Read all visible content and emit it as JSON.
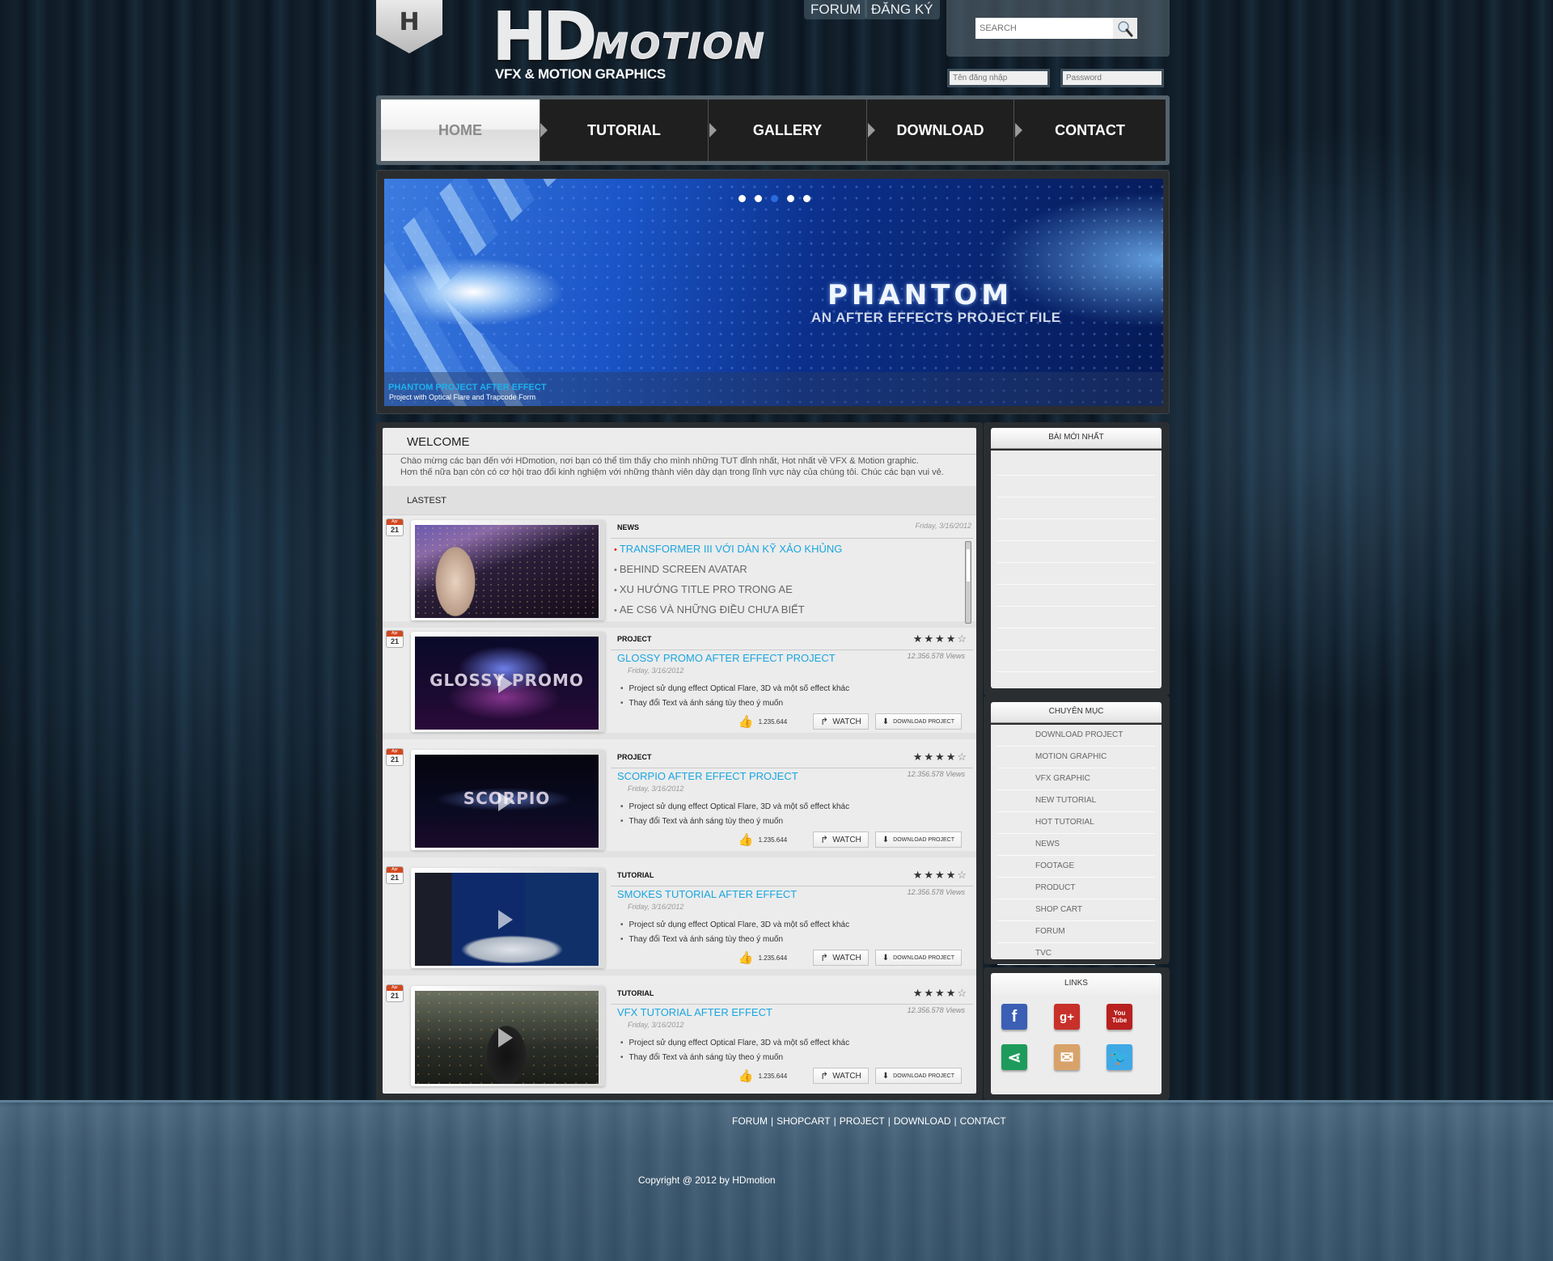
{
  "header": {
    "logo_badge_letter": "H",
    "logo_hd": "HD",
    "logo_motion": "MOTION",
    "tagline": "VFX & MOTION GRAPHICS",
    "top_links": [
      "FORUM",
      "ĐĂNG KÝ"
    ],
    "search_placeholder": "SEARCH",
    "search_icon": "magnifier-icon",
    "username_placeholder": "Tên đăng nhập",
    "password_placeholder": "Password"
  },
  "nav": {
    "items": [
      {
        "label": "HOME",
        "active": true
      },
      {
        "label": "TUTORIAL",
        "active": false
      },
      {
        "label": "GALLERY",
        "active": false
      },
      {
        "label": "DOWNLOAD",
        "active": false
      },
      {
        "label": "CONTACT",
        "active": false
      }
    ]
  },
  "banner": {
    "title": "PHANTOM",
    "subtitle": "AN AFTER EFFECTS PROJECT FILE",
    "caption_title": "PHANTOM PROJECT AFTER EFFECT",
    "caption_desc": "Project  with Optical Flare and Trapcode Form",
    "slide_count": 5,
    "active_slide": 3
  },
  "welcome": {
    "title": "WELCOME",
    "line1": "Chào mừng các bạn đến với HDmotion, nơi bạn có thể tìm thấy cho mình những TUT đỉnh nhất, Hot nhất về VFX & Motion graphic.",
    "line2": "Hơn thế nữa bạn còn có cơ hội trao đổi kinh nghiệm với những thành viên dày dạn trong lĩnh vực này của chúng tôi. Chúc các bạn vui vẻ.",
    "latest_title": "LASTEST"
  },
  "news": {
    "cal_month": "Apr",
    "cal_day": "21",
    "category": "NEWS",
    "date": "Friday, 3/16/2012",
    "items": [
      {
        "label": "TRANSFORMER III VỚI DÀN KỸ XẢO KHỦNG",
        "hot": true
      },
      {
        "label": "BEHIND SCREEN AVATAR",
        "hot": false
      },
      {
        "label": "XU HƯỚNG TITLE PRO TRONG AE",
        "hot": false
      },
      {
        "label": "AE CS6 VÀ NHỮNG ĐIỀU CHƯA BIẾT",
        "hot": false
      }
    ]
  },
  "posts": [
    {
      "cal_month": "Apr",
      "cal_day": "21",
      "category": "PROJECT",
      "title": "GLOSSY PROMO AFTER EFFECT PROJECT",
      "date": "Friday, 3/16/2012",
      "views": "12.356.578  Views",
      "rating": 4,
      "rating_max": 5,
      "bullets": [
        "Project sử dụng effect Optical Flare, 3D và một số effect khác",
        "Thay đổi Text và ánh sáng tùy theo ý  muốn"
      ],
      "likes": "1.235.644",
      "watch_label": "WATCH",
      "download_label": "DOWNLOAD PROJECT",
      "thumb_text": "GLOSSY PROMO"
    },
    {
      "cal_month": "Apr",
      "cal_day": "21",
      "category": "PROJECT",
      "title": "SCORPIO  AFTER EFFECT PROJECT",
      "date": "Friday, 3/16/2012",
      "views": "12.356.578  Views",
      "rating": 4,
      "rating_max": 5,
      "bullets": [
        "Project sử dụng effect Optical Flare, 3D và một số effect khác",
        "Thay đổi Text và ánh sáng tùy theo ý  muốn"
      ],
      "likes": "1.235.644",
      "watch_label": "WATCH",
      "download_label": "DOWNLOAD PROJECT",
      "thumb_text": "SCORPIO"
    },
    {
      "cal_month": "Apr",
      "cal_day": "21",
      "category": "TUTORIAL",
      "title": "SMOKES TUTORIAL AFTER EFFECT",
      "date": "Friday, 3/16/2012",
      "views": "12.356.578  Views",
      "rating": 4,
      "rating_max": 5,
      "bullets": [
        "Project sử dụng effect Optical Flare, 3D và một số effect khác",
        "Thay đổi Text và ánh sáng tùy theo ý  muốn"
      ],
      "likes": "1.235.644",
      "watch_label": "WATCH",
      "download_label": "DOWNLOAD PROJECT",
      "thumb_text": ""
    },
    {
      "cal_month": "Apr",
      "cal_day": "21",
      "category": "TUTORIAL",
      "title": "VFX TUTORIAL AFTER EFFECT",
      "date": "Friday, 3/16/2012",
      "views": "12.356.578  Views",
      "rating": 4,
      "rating_max": 5,
      "bullets": [
        "Project sử dụng effect Optical Flare, 3D và một số effect khác",
        "Thay đổi Text và ánh sáng tùy theo ý  muốn"
      ],
      "likes": "1.235.644",
      "watch_label": "WATCH",
      "download_label": "DOWNLOAD PROJECT",
      "thumb_text": ""
    }
  ],
  "sidebar": {
    "newest_title": "BÀI MỚI NHẤT",
    "categories_title": "CHUYÊN MỤC",
    "categories": [
      "DOWNLOAD PROJECT",
      "MOTION GRAPHIC",
      "VFX GRAPHIC",
      "NEW TUTORIAL",
      "HOT TUTORIAL",
      "NEWS",
      "FOOTAGE",
      "PRODUCT",
      "SHOP CART",
      "FORUM",
      "TVC"
    ],
    "links_title": "LINKS",
    "social": [
      {
        "name": "facebook",
        "glyph": "f",
        "color": "#3b5fb4"
      },
      {
        "name": "google-plus",
        "glyph": "g+",
        "color": "#c8302a"
      },
      {
        "name": "youtube",
        "glyph": "You Tube",
        "color": "#b8211f"
      },
      {
        "name": "share",
        "glyph": "⋖",
        "color": "#1e9b5c"
      },
      {
        "name": "email",
        "glyph": "✉",
        "color": "#d8a36a"
      },
      {
        "name": "twitter",
        "glyph": "🐦",
        "color": "#3fa9e6"
      }
    ]
  },
  "footer": {
    "links": [
      "FORUM",
      "SHOPCART",
      "PROJECT",
      "DOWNLOAD",
      "CONTACT"
    ],
    "copyright": "Copyright @ 2012 by HDmotion"
  }
}
